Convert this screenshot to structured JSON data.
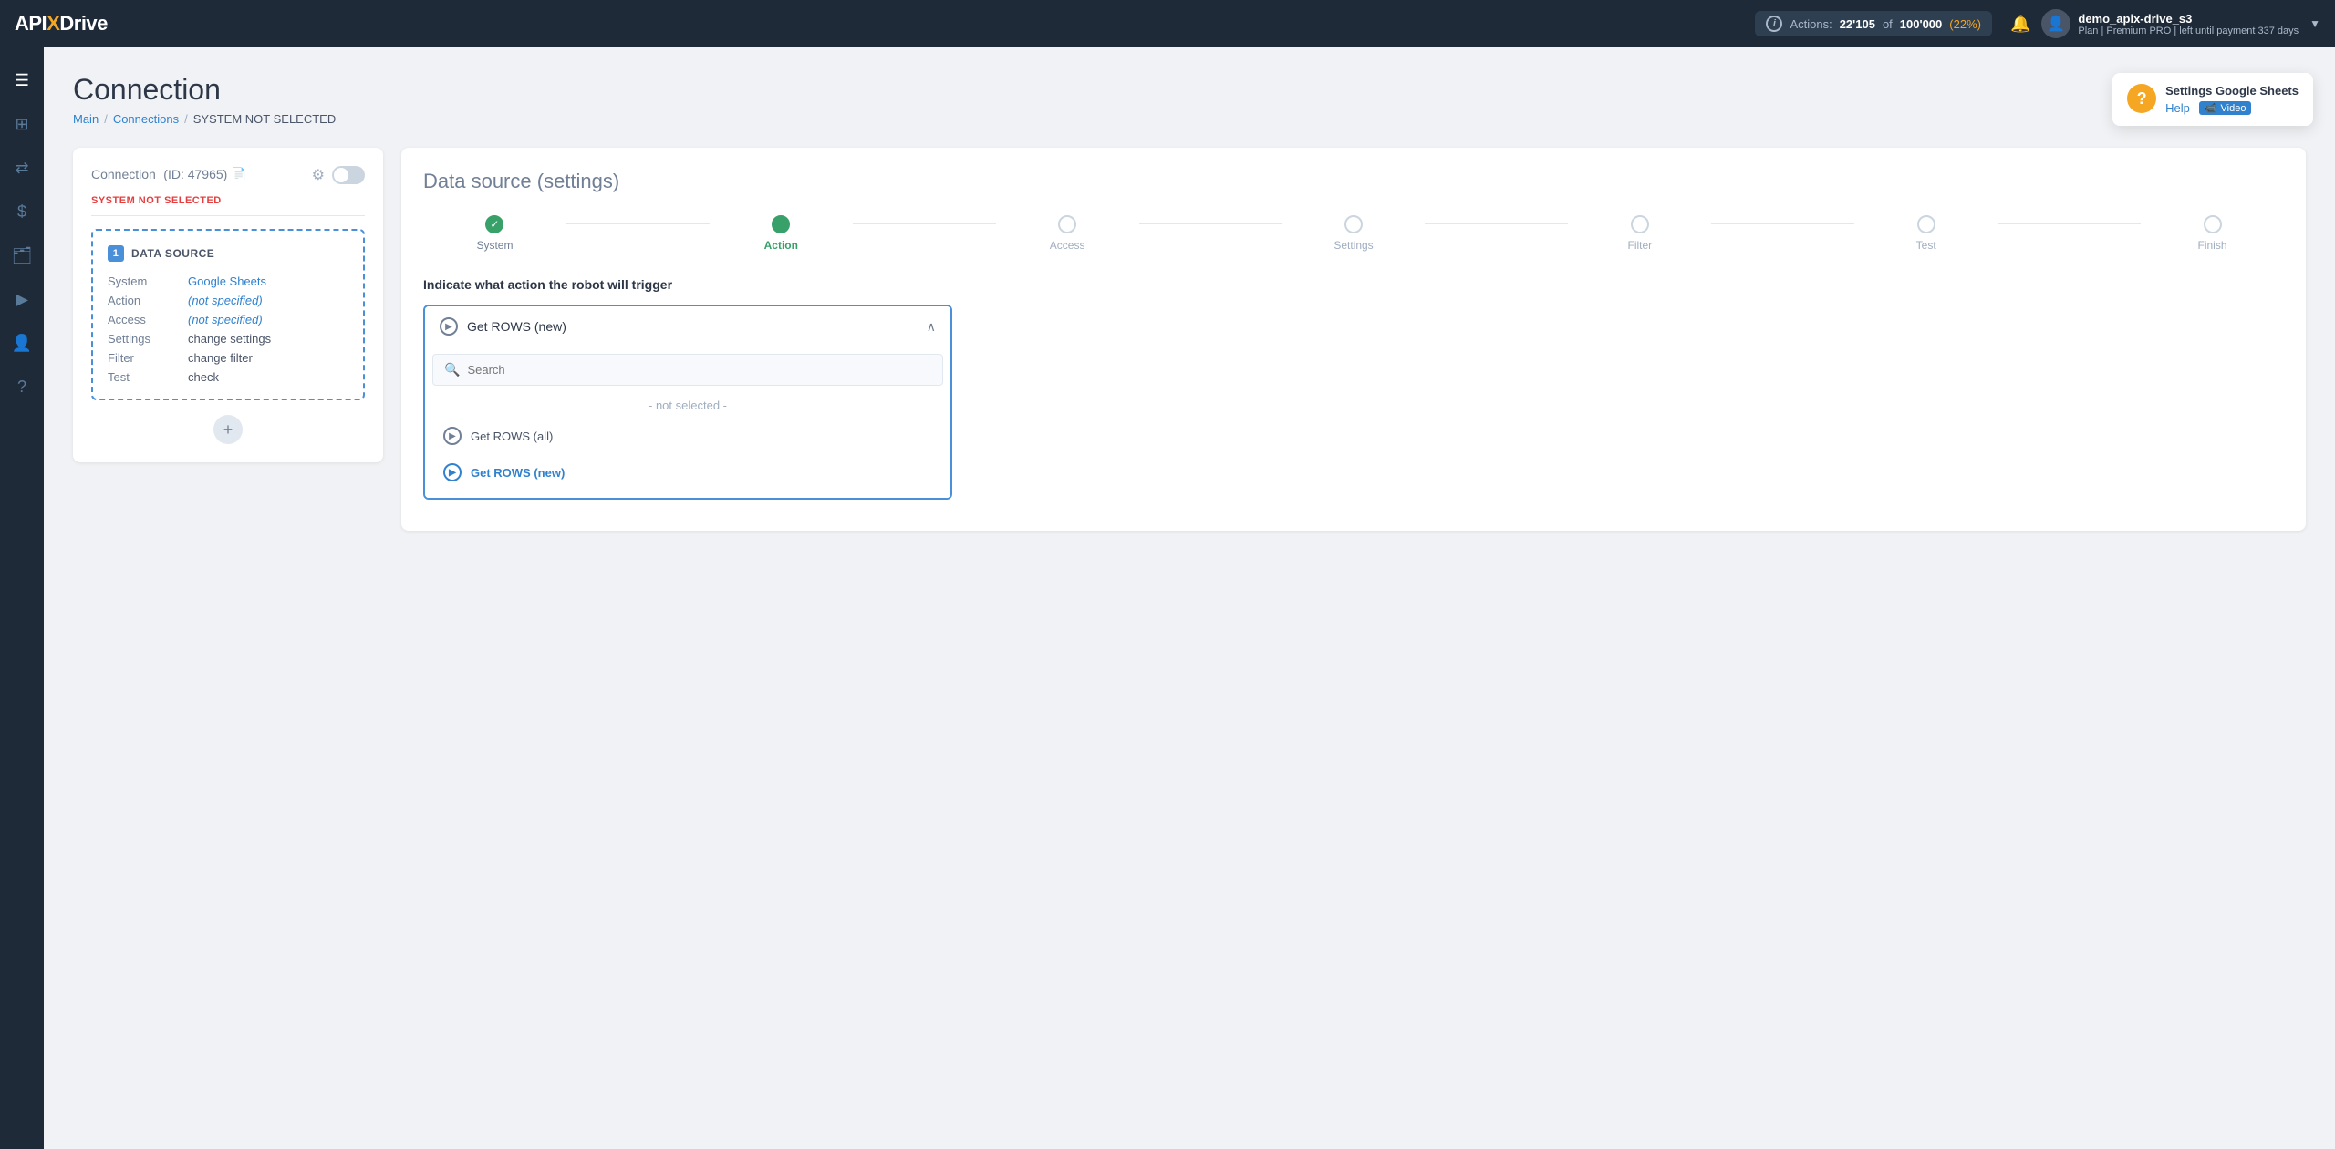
{
  "topnav": {
    "logo": {
      "api": "API",
      "x": "X",
      "drive": "Drive"
    },
    "actions": {
      "label": "Actions:",
      "used": "22'105",
      "total": "100'000",
      "pct": "(22%)"
    },
    "user": {
      "name": "demo_apix-drive_s3",
      "plan": "Plan | Premium PRO | left until payment 337 days"
    },
    "chevron": "▼"
  },
  "sidebar": {
    "items": [
      {
        "icon": "☰",
        "name": "menu-icon"
      },
      {
        "icon": "⊞",
        "name": "grid-icon"
      },
      {
        "icon": "⇄",
        "name": "connections-icon"
      },
      {
        "icon": "$",
        "name": "billing-icon"
      },
      {
        "icon": "💼",
        "name": "projects-icon"
      },
      {
        "icon": "▶",
        "name": "play-icon"
      },
      {
        "icon": "👤",
        "name": "profile-icon"
      },
      {
        "icon": "?",
        "name": "help-icon"
      }
    ]
  },
  "page": {
    "title": "Connection",
    "breadcrumb": {
      "main": "Main",
      "connections": "Connections",
      "current": "SYSTEM NOT SELECTED"
    }
  },
  "left_card": {
    "title": "Connection",
    "id_label": "(ID: 47965)",
    "system_status": "SYSTEM",
    "not_selected": "NOT SELECTED",
    "datasource": {
      "number": "1",
      "label": "DATA SOURCE",
      "rows": [
        {
          "label": "System",
          "value": "Google Sheets",
          "type": "link"
        },
        {
          "label": "Action",
          "value": "(not specified)",
          "type": "link-italic"
        },
        {
          "label": "Access",
          "value": "(not specified)",
          "type": "link-italic"
        },
        {
          "label": "Settings",
          "value": "change settings",
          "type": "plain"
        },
        {
          "label": "Filter",
          "value": "change filter",
          "type": "plain"
        },
        {
          "label": "Test",
          "value": "check",
          "type": "plain"
        }
      ]
    },
    "add_btn": "+"
  },
  "right_card": {
    "title": "Data source",
    "title_sub": "(settings)",
    "stepper": [
      {
        "label": "System",
        "state": "completed"
      },
      {
        "label": "Action",
        "state": "active"
      },
      {
        "label": "Access",
        "state": "inactive"
      },
      {
        "label": "Settings",
        "state": "inactive"
      },
      {
        "label": "Filter",
        "state": "inactive"
      },
      {
        "label": "Test",
        "state": "inactive"
      },
      {
        "label": "Finish",
        "state": "inactive"
      }
    ],
    "action_prompt": "Indicate what action the robot will trigger",
    "dropdown": {
      "selected": "Get ROWS (new)",
      "search_placeholder": "Search",
      "options": [
        {
          "label": "- not selected -",
          "type": "placeholder"
        },
        {
          "label": "Get ROWS (all)",
          "type": "option"
        },
        {
          "label": "Get ROWS (new)",
          "type": "option-selected"
        }
      ]
    }
  },
  "help_bubble": {
    "title": "Settings Google Sheets",
    "help_label": "Help",
    "video_label": "📹 Video"
  }
}
